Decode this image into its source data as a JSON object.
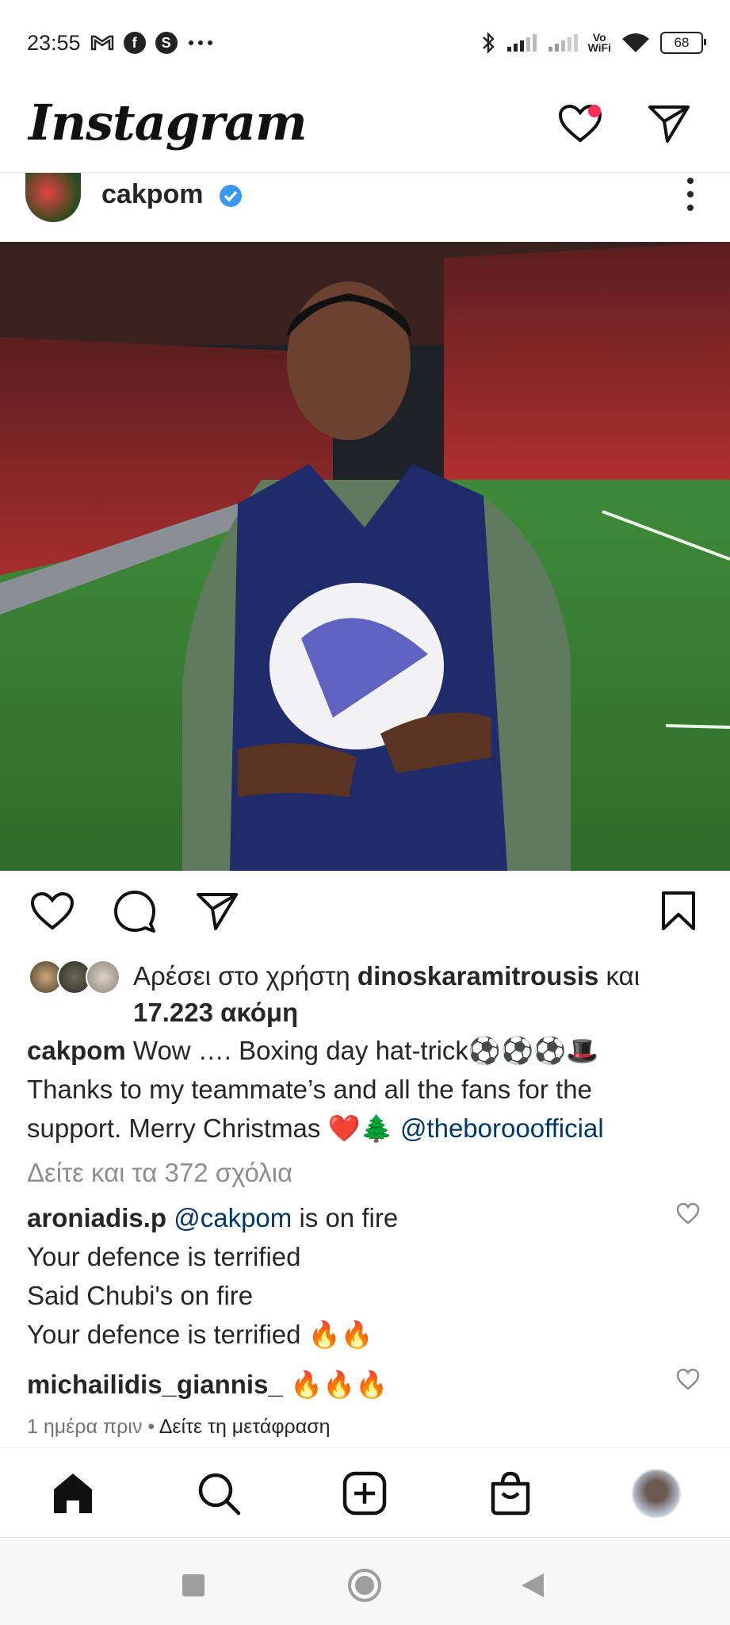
{
  "status_bar": {
    "time": "23:55",
    "left_icons": [
      "gmail-icon",
      "facebook-icon",
      "shazam-icon",
      "more-dots-icon"
    ],
    "right_icons": [
      "bluetooth-icon",
      "signal-icon",
      "signal-icon",
      "vowifi-icon",
      "wifi-icon",
      "battery-icon"
    ],
    "vowifi_label": "Vo\nWiFi",
    "battery": "68"
  },
  "header": {
    "logo": "Instagram",
    "icons": [
      "heart-icon",
      "send-icon"
    ],
    "notification_dot_color": "#ff2d55"
  },
  "post": {
    "username": "cakpom",
    "verified_color": "#3897f0",
    "likes": {
      "prefix": "Αρέσει στο χρήστη ",
      "user": "dinoskaramitrousis",
      "suffix": " και",
      "count": "17.223 ακόμη"
    },
    "caption": {
      "username": "cakpom",
      "text_line1": " Wow …. Boxing day hat-trick⚽⚽⚽🎩",
      "text_line2": "Thanks to my teammate’s and all the fans for the",
      "text_line3": "support. Merry Christmas ❤️🌲 ",
      "mention": "@theborooofficial"
    },
    "view_comments": "Δείτε και τα 372 σχόλια",
    "comments": [
      {
        "username": "aroniadis.p",
        "mention": "@cakpom",
        "line1_rest": " is on fire",
        "line2": "Your defence is terrified",
        "line3": "Said Chubi's on fire",
        "line4": "Your defence is terrified 🔥🔥"
      },
      {
        "username": "michailidis_giannis_",
        "text": " 🔥🔥🔥"
      }
    ],
    "time_ago": "1 ημέρα πριν",
    "separator": " • ",
    "translate": "Δείτε τη μετάφραση"
  },
  "bottom_nav": [
    "home-icon",
    "search-icon",
    "add-post-icon",
    "shop-icon",
    "profile-avatar"
  ],
  "system_nav": [
    "recents-button",
    "home-button",
    "back-button"
  ]
}
